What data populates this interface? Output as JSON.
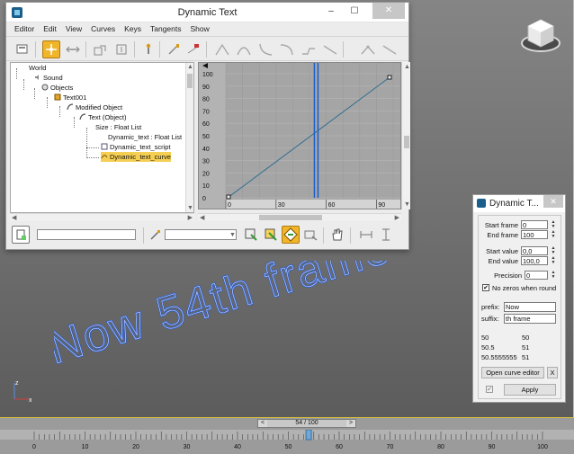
{
  "curve_editor": {
    "title": "Dynamic Text",
    "window_buttons": {
      "minimize": "–",
      "maximize": "☐",
      "close": "✕"
    },
    "menu": [
      "Editor",
      "Edit",
      "View",
      "Curves",
      "Keys",
      "Tangents",
      "Show"
    ],
    "toolbar_icons": [
      "filter-icon",
      "move-keys-icon",
      "slide-keys-icon",
      "scale-keys-icon",
      "scale-values-icon",
      "add-keys-icon",
      "draw-curves-icon",
      "reduce-keys-icon",
      "auto-tangent-icon",
      "spline-tangent-icon",
      "fast-tangent-icon",
      "slow-tangent-icon",
      "step-tangent-icon",
      "linear-tangent-icon",
      "smooth-tangent-icon",
      "parameter-out-of-range-icon",
      "loop-icon"
    ],
    "tree": [
      {
        "label": "World",
        "depth": 0,
        "icon": "none"
      },
      {
        "label": "Sound",
        "depth": 1,
        "icon": "sound-icon"
      },
      {
        "label": "Objects",
        "depth": 1,
        "icon": "objects-icon"
      },
      {
        "label": "Text001",
        "depth": 2,
        "icon": "object-icon"
      },
      {
        "label": "Modified Object",
        "depth": 3,
        "icon": "modifier-icon"
      },
      {
        "label": "Text (Object)",
        "depth": 4,
        "icon": "modifier-icon"
      },
      {
        "label": "Size : Float List",
        "depth": 5,
        "icon": "none"
      },
      {
        "label": "Dynamic_text : Float List",
        "depth": 6,
        "icon": "none"
      },
      {
        "label": "Dynamic_text_script",
        "depth": 7,
        "icon": "script-icon"
      },
      {
        "label": "Dynamic_text_curve",
        "depth": 7,
        "icon": "curve-icon",
        "selected": true
      }
    ],
    "graph": {
      "y_labels": [
        "100",
        "90",
        "80",
        "70",
        "60",
        "50",
        "40",
        "30",
        "20",
        "10",
        "0"
      ],
      "x_labels": [
        "0",
        "30",
        "60",
        "90"
      ],
      "key_start": {
        "frame": 0,
        "value": 0
      },
      "key_end": {
        "frame": 100,
        "value": 100
      },
      "current_frame": 54
    }
  },
  "dynamic_panel": {
    "title": "Dynamic T...",
    "close": "✕",
    "start_frame_label": "Start frame",
    "start_frame": "0",
    "end_frame_label": "End frame",
    "end_frame": "100",
    "start_value_label": "Start value",
    "start_value": "0,0",
    "end_value_label": "End value",
    "end_value": "100,0",
    "precision_label": "Precision",
    "precision": "0",
    "no_zeros_label": "No zeros when round",
    "no_zeros_checked": "✔",
    "prefix_label": "prefix:",
    "prefix": "Now",
    "suffix_label": "suffix:",
    "suffix": "th frame",
    "results": [
      {
        "left": "50",
        "right": "50"
      },
      {
        "left": "50.5",
        "right": "51"
      },
      {
        "left": "50.5555555",
        "right": "51"
      }
    ],
    "open_curve_label": "Open curve editor",
    "x_label": "X",
    "apply_check": "✔",
    "apply_label": "Apply"
  },
  "viewport_text": "Now 54th frame",
  "gizmo": {
    "x": "x",
    "z": "z"
  },
  "timeline": {
    "slider_label": "54 / 100",
    "prev": "<",
    "next": ">",
    "ticks": [
      "0",
      "10",
      "20",
      "30",
      "40",
      "50",
      "60",
      "70",
      "80",
      "90",
      "100"
    ]
  }
}
